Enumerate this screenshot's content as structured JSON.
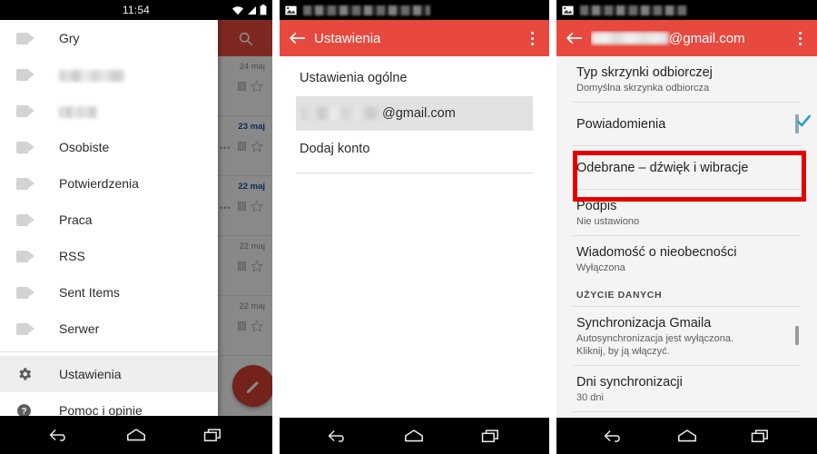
{
  "panel1": {
    "name": "gmail-navigation-drawer",
    "statusbar": {
      "time": "11:54",
      "icons": [
        "wifi-icon",
        "signal-icon",
        "battery-icon"
      ]
    },
    "drawer": {
      "items": [
        {
          "label": "Gry",
          "icon": "label-tag-icon",
          "redacted": false,
          "selected": false
        },
        {
          "label": "",
          "icon": "label-tag-icon",
          "redacted": true,
          "redact_width": 72,
          "selected": false
        },
        {
          "label": "",
          "icon": "label-tag-icon",
          "redacted": true,
          "redact_width": 42,
          "selected": false
        },
        {
          "label": "Osobiste",
          "icon": "label-tag-icon",
          "redacted": false,
          "selected": false
        },
        {
          "label": "Potwierdzenia",
          "icon": "label-tag-icon",
          "redacted": false,
          "selected": false
        },
        {
          "label": "Praca",
          "icon": "label-tag-icon",
          "redacted": false,
          "selected": false
        },
        {
          "label": "RSS",
          "icon": "label-tag-icon",
          "redacted": false,
          "selected": false
        },
        {
          "label": "Sent Items",
          "icon": "label-tag-icon",
          "redacted": false,
          "selected": false
        },
        {
          "label": "Serwer",
          "icon": "label-tag-icon",
          "redacted": false,
          "selected": false
        }
      ],
      "footer_items": [
        {
          "label": "Ustawienia",
          "icon": "gear-icon",
          "selected": true
        },
        {
          "label": "Pomoc i opinie",
          "icon": "help-circle-icon",
          "selected": false
        }
      ]
    },
    "maillist": {
      "search_icon": "search-icon",
      "compose_icon": "pencil-compose-icon",
      "rows": [
        {
          "date": "24 maj",
          "unread": false
        },
        {
          "date": "23 maj",
          "unread": true
        },
        {
          "date": "22 maj",
          "unread": true
        },
        {
          "date": "22 maj",
          "unread": false
        },
        {
          "date": "22 maj",
          "unread": false
        }
      ]
    }
  },
  "panel2": {
    "name": "gmail-settings-screen",
    "statusbar": {
      "left_icon": "screenshot-image-icon",
      "notification_text_redacted": true
    },
    "appbar": {
      "back_icon": "back-arrow-icon",
      "title": "Ustawienia",
      "overflow_icon": "overflow-menu-icon"
    },
    "rows": [
      {
        "label": "Ustawienia ogólne",
        "highlight": false,
        "redacted": false
      },
      {
        "label": "@gmail.com",
        "highlight": true,
        "redacted": true,
        "redact_width": 88
      },
      {
        "label": "Dodaj konto",
        "highlight": false,
        "redacted": false
      }
    ]
  },
  "panel3": {
    "name": "gmail-account-settings-screen",
    "statusbar": {
      "left_icon": "screenshot-image-icon",
      "notification_text_redacted": true
    },
    "appbar": {
      "back_icon": "back-arrow-icon",
      "title": "@gmail.com",
      "title_redacted": true,
      "redact_width": 86,
      "overflow_icon": "overflow-menu-icon"
    },
    "rows": [
      {
        "type": "item",
        "title": "Typ skrzynki odbiorczej",
        "sub": "Domyślna skrzynka odbiorcza",
        "control": "none"
      },
      {
        "type": "item",
        "title": "Powiadomienia",
        "sub": "",
        "control": "checkbox",
        "checked": true,
        "highlighted": true
      },
      {
        "type": "item",
        "title": "Odebrane – dźwięk i wibracje",
        "sub": "",
        "control": "none"
      },
      {
        "type": "item",
        "title": "Podpis",
        "sub": "Nie ustawiono",
        "control": "none"
      },
      {
        "type": "item",
        "title": "Wiadomość o nieobecności",
        "sub": "Wyłączona",
        "control": "none"
      },
      {
        "type": "section",
        "title": "UŻYCIE DANYCH"
      },
      {
        "type": "item",
        "title": "Synchronizacja Gmaila",
        "sub": "Autosynchronizacja jest wyłączona. Kliknij, by ją włączyć.",
        "control": "checkbox",
        "checked": false
      },
      {
        "type": "item",
        "title": "Dni synchronizacji",
        "sub": "30 dni",
        "control": "none"
      }
    ]
  },
  "navbar": {
    "back_icon": "nav-back-icon",
    "home_icon": "nav-home-icon",
    "recents_icon": "nav-recents-icon"
  },
  "colors": {
    "appbar_red": "#e8493f",
    "fab_red": "#d23f34",
    "highlight_red": "#e60000",
    "checkbox_teal": "#2a9fc4",
    "unread_blue": "#12509c",
    "panel3_bg": "#f4f4f4"
  }
}
